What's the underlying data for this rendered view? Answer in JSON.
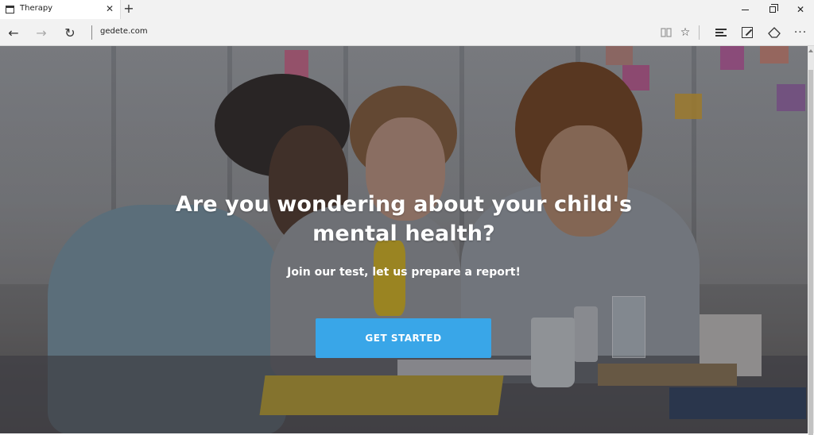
{
  "browser": {
    "tab_title": "Therapy",
    "tab_close": "✕",
    "new_tab": "+",
    "address": "gedete.com",
    "back": "←",
    "forward": "→",
    "refresh": "↻",
    "more": "···",
    "favorite": "☆",
    "minimize_icon": "minimize-icon",
    "close": "✕"
  },
  "hero": {
    "title_line1": "Are you wondering about your child's",
    "title_line2": "mental health?",
    "subtitle": "Join our test, let us prepare a report!",
    "cta_label": "GET STARTED"
  },
  "colors": {
    "cta": "#39a6e8",
    "text": "#ffffff"
  }
}
